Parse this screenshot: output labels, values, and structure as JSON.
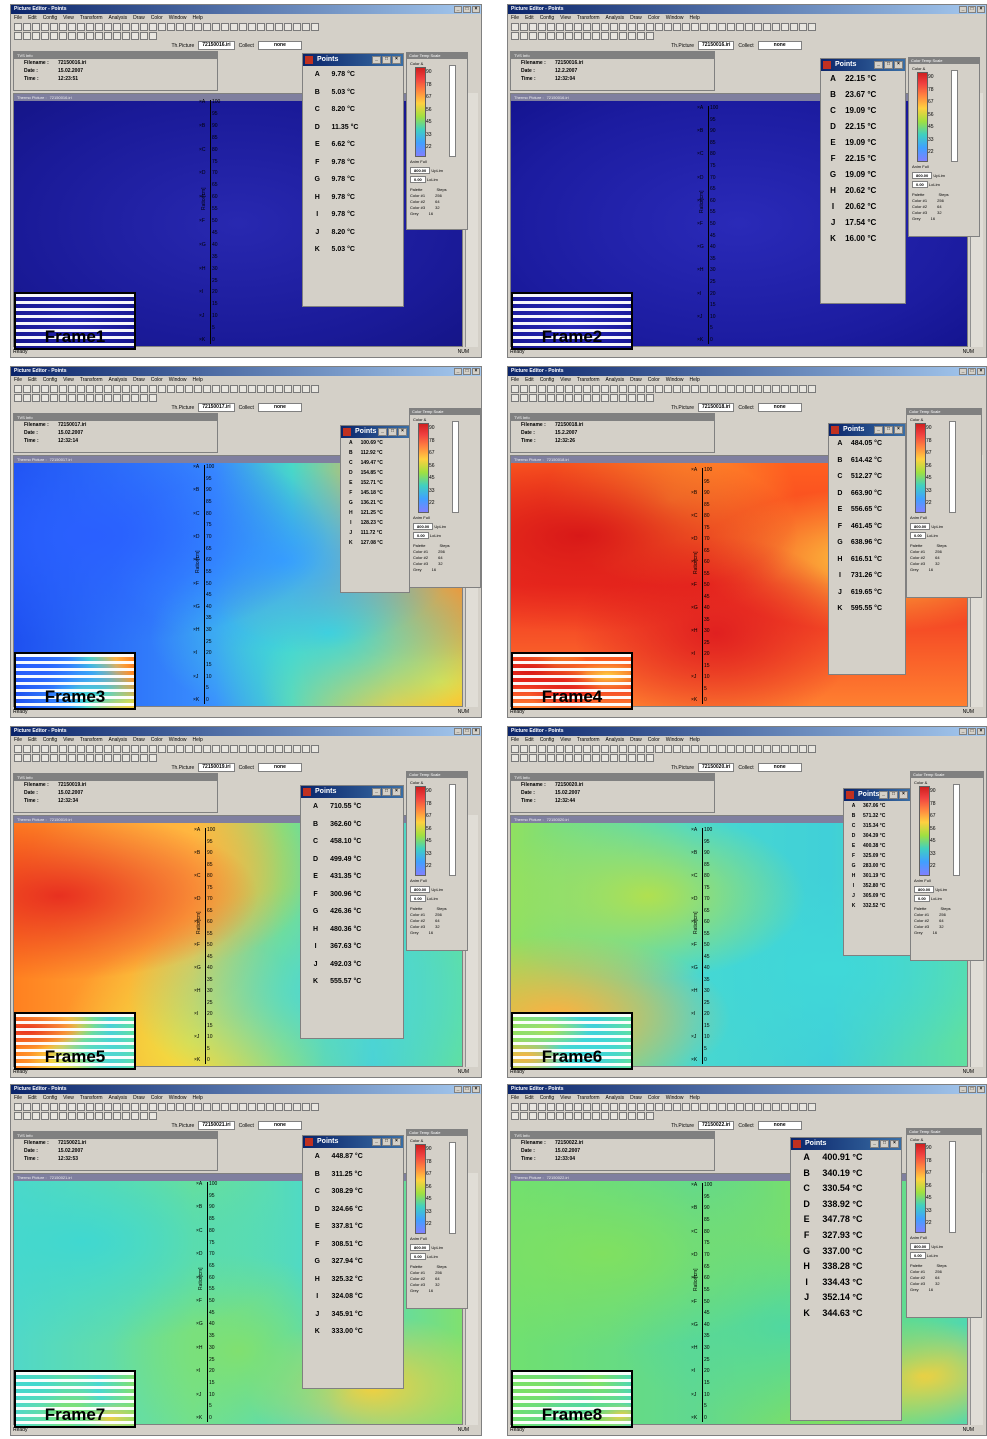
{
  "app": {
    "title": "Picture Editor - Points",
    "menu": [
      "File",
      "Edit",
      "Config",
      "View",
      "Transform",
      "Analysis",
      "Draw",
      "Color",
      "Window",
      "Help"
    ],
    "toolbar": {
      "th_picture_label": "Th.Picture",
      "collect_label": "Collect",
      "collect_value": "none"
    },
    "tvs_info_title": "TVS Info",
    "filename_label": "Filename :",
    "date_label": "Date :",
    "time_label": "Time :",
    "points_title": "Points",
    "scale_title": "Color Temp Scale",
    "scale_color": "Color &",
    "scale_ticks": [
      "90",
      "78",
      "67",
      "56",
      "45",
      "33",
      "22"
    ],
    "scale_uplim": "UpLim",
    "scale_lolim": "LoLim",
    "scale_up_value": "800.00",
    "scale_lo_value": "0.00",
    "scale_anim": "Anim",
    "scale_full": "Full",
    "palette_label": "Palette",
    "steps_label": "Steps",
    "palette_options": [
      "Color #1",
      "Color #2",
      "Color #3",
      "Grey"
    ],
    "steps_options": [
      "256",
      "64",
      "32",
      "16"
    ],
    "ruler_ticks": [
      "100",
      "95",
      "90",
      "85",
      "80",
      "75",
      "70",
      "65",
      "60",
      "55",
      "50",
      "45",
      "40",
      "35",
      "30",
      "25",
      "20",
      "15",
      "10",
      "5",
      "0"
    ],
    "ruler_label": "Ratio [cm]",
    "status_ready": "Ready",
    "status_num": "NUM",
    "thermo_title_prefix": "Thermo Picture :"
  },
  "point_letters": [
    "A",
    "B",
    "C",
    "D",
    "E",
    "F",
    "G",
    "H",
    "I",
    "J",
    "K"
  ],
  "frames": [
    {
      "label": "Frame1",
      "filename": "72150016.iri",
      "date": "15.02.2007",
      "time": "12:23:51",
      "thermo_file": "72150016.iri",
      "values": [
        "9.78 °C",
        "5.03 °C",
        "8.20 °C",
        "11.35 °C",
        "6.62 °C",
        "9.78 °C",
        "9.78 °C",
        "9.78 °C",
        "9.78 °C",
        "8.20 °C",
        "5.03 °C"
      ]
    },
    {
      "label": "Frame2",
      "filename": "72150016.iri",
      "date": "12.2.2007",
      "time": "12:32:04",
      "thermo_file": "72150016.iri",
      "values": [
        "22.15 °C",
        "23.67 °C",
        "19.09 °C",
        "22.15 °C",
        "19.09 °C",
        "22.15 °C",
        "19.09 °C",
        "20.62 °C",
        "20.62 °C",
        "17.54 °C",
        "16.00 °C"
      ]
    },
    {
      "label": "Frame3",
      "filename": "72150017.iri",
      "date": "15.02.2007",
      "time": "12:32:14",
      "thermo_file": "72150017.iri",
      "values": [
        "100.69 °C",
        "112.92 °C",
        "149.47 °C",
        "154.85 °C",
        "152.71 °C",
        "145.18 °C",
        "136.21 °C",
        "121.25 °C",
        "128.23 °C",
        "111.72 °C",
        "127.08 °C"
      ]
    },
    {
      "label": "Frame4",
      "filename": "72150018.iri",
      "date": "15.2.2007",
      "time": "12:32:26",
      "thermo_file": "72150018.iri",
      "values": [
        "484.05 °C",
        "614.42 °C",
        "512.27 °C",
        "663.90 °C",
        "556.65 °C",
        "461.45 °C",
        "638.96 °C",
        "616.51 °C",
        "731.26 °C",
        "619.65 °C",
        "595.55 °C"
      ]
    },
    {
      "label": "Frame5",
      "filename": "72150019.iri",
      "date": "15.02.2007",
      "time": "12:32:34",
      "thermo_file": "72150019.iri",
      "values": [
        "710.55 °C",
        "362.60 °C",
        "458.10 °C",
        "499.49 °C",
        "431.35 °C",
        "300.96 °C",
        "426.36 °C",
        "480.36 °C",
        "367.63 °C",
        "492.03 °C",
        "555.57 °C"
      ]
    },
    {
      "label": "Frame6",
      "filename": "72150020.iri",
      "date": "15.02.2007",
      "time": "12:32:44",
      "thermo_file": "72150020.iri",
      "values": [
        "367.06 °C",
        "571.32 °C",
        "315.34 °C",
        "304.39 °C",
        "400.38 °C",
        "325.09 °C",
        "283.00 °C",
        "301.19 °C",
        "352.80 °C",
        "305.09 °C",
        "332.52 °C"
      ]
    },
    {
      "label": "Frame7",
      "filename": "72150021.iri",
      "date": "15.02.2007",
      "time": "12:32:53",
      "thermo_file": "72150021.iri",
      "values": [
        "448.87 °C",
        "311.25 °C",
        "308.29 °C",
        "324.66 °C",
        "337.81 °C",
        "308.51 °C",
        "327.94 °C",
        "325.32 °C",
        "324.08 °C",
        "345.91 °C",
        "333.00 °C"
      ]
    },
    {
      "label": "Frame8",
      "filename": "72150022.iri",
      "date": "15.02.2007",
      "time": "12:33:04",
      "thermo_file": "72150022.iri",
      "values": [
        "400.91 °C",
        "340.19 °C",
        "330.54 °C",
        "338.92 °C",
        "347.78 °C",
        "327.93 °C",
        "337.00 °C",
        "338.28 °C",
        "334.43 °C",
        "352.14 °C",
        "344.63 °C"
      ]
    }
  ],
  "colors": {
    "deep_blue": "#1a1aa0",
    "cold_blue": "#2060ff",
    "cyan": "#40d8d8",
    "green": "#60d060",
    "yellow": "#f0e040",
    "orange": "#ff8c20",
    "red": "#e02020"
  }
}
